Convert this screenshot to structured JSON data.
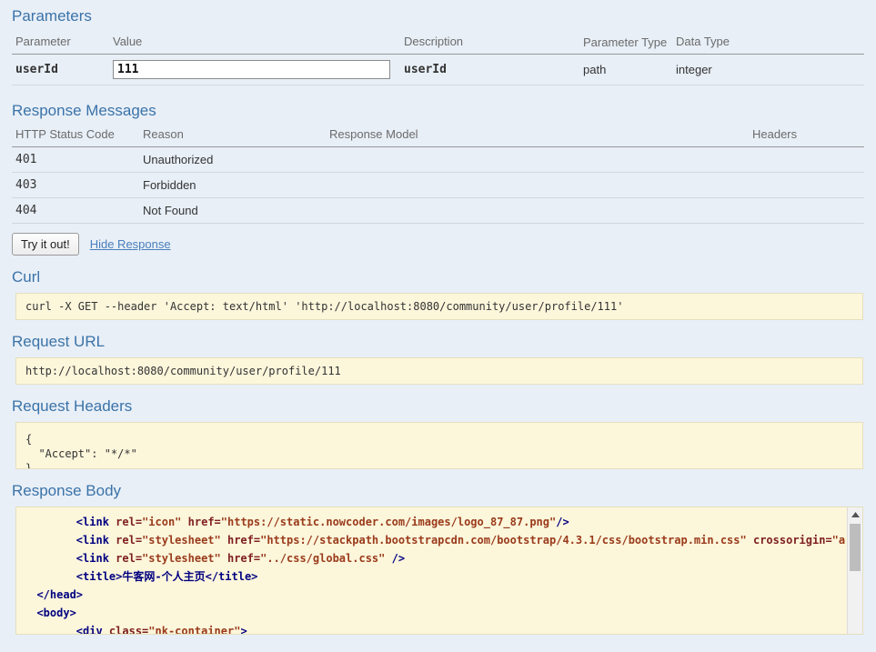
{
  "parameters": {
    "title": "Parameters",
    "headers": [
      "Parameter",
      "Value",
      "Description",
      "Parameter Type",
      "Data Type"
    ],
    "rows": [
      {
        "name": "userId",
        "value": "111",
        "description": "userId",
        "parameter_type": "path",
        "data_type": "integer"
      }
    ]
  },
  "response_messages": {
    "title": "Response Messages",
    "headers": [
      "HTTP Status Code",
      "Reason",
      "Response Model",
      "Headers"
    ],
    "rows": [
      {
        "code": "401",
        "reason": "Unauthorized",
        "model": "",
        "headers": ""
      },
      {
        "code": "403",
        "reason": "Forbidden",
        "model": "",
        "headers": ""
      },
      {
        "code": "404",
        "reason": "Not Found",
        "model": "",
        "headers": ""
      }
    ]
  },
  "actions": {
    "try_it_out": "Try it out!",
    "hide_response": "Hide Response"
  },
  "curl": {
    "title": "Curl",
    "command": "curl -X GET --header 'Accept: text/html' 'http://localhost:8080/community/user/profile/111'"
  },
  "request_url": {
    "title": "Request URL",
    "url": "http://localhost:8080/community/user/profile/111"
  },
  "request_headers": {
    "title": "Request Headers",
    "body": "{\n  \"Accept\": \"*/*\"\n}"
  },
  "response_body": {
    "title": "Response Body",
    "lines": [
      {
        "indent": 8,
        "parts": [
          {
            "t": "tag",
            "s": "<link "
          },
          {
            "t": "attr",
            "s": "rel="
          },
          {
            "t": "val",
            "s": "\"icon\" "
          },
          {
            "t": "attr",
            "s": "href="
          },
          {
            "t": "val",
            "s": "\"https://static.nowcoder.com/images/logo_87_87.png\""
          },
          {
            "t": "tag",
            "s": "/>"
          }
        ]
      },
      {
        "indent": 8,
        "parts": [
          {
            "t": "tag",
            "s": "<link "
          },
          {
            "t": "attr",
            "s": "rel="
          },
          {
            "t": "val",
            "s": "\"stylesheet\" "
          },
          {
            "t": "attr",
            "s": "href="
          },
          {
            "t": "val",
            "s": "\"https://stackpath.bootstrapcdn.com/bootstrap/4.3.1/css/bootstrap.min.css\" "
          },
          {
            "t": "attr",
            "s": "crossorigin="
          },
          {
            "t": "val",
            "s": "\"a"
          }
        ]
      },
      {
        "indent": 8,
        "parts": [
          {
            "t": "tag",
            "s": "<link "
          },
          {
            "t": "attr",
            "s": "rel="
          },
          {
            "t": "val",
            "s": "\"stylesheet\" "
          },
          {
            "t": "attr",
            "s": "href="
          },
          {
            "t": "val",
            "s": "\"../css/global.css\" "
          },
          {
            "t": "tag",
            "s": "/>"
          }
        ]
      },
      {
        "indent": 8,
        "parts": [
          {
            "t": "tag",
            "s": "<title>"
          },
          {
            "t": "txt",
            "s": "牛客网-个人主页"
          },
          {
            "t": "tag",
            "s": "</title>"
          }
        ]
      },
      {
        "indent": 2,
        "parts": [
          {
            "t": "tag",
            "s": "</head>"
          }
        ]
      },
      {
        "indent": 2,
        "parts": [
          {
            "t": "tag",
            "s": "<body>"
          }
        ]
      },
      {
        "indent": 8,
        "parts": [
          {
            "t": "tag",
            "s": "<div "
          },
          {
            "t": "attr",
            "s": "class="
          },
          {
            "t": "val",
            "s": "\"nk-container\""
          },
          {
            "t": "tag",
            "s": ">"
          }
        ]
      }
    ]
  },
  "colors": {
    "page_background": "#e8eff7",
    "heading": "#3b73a8",
    "code_background": "#fcf6db",
    "link": "#4a7fbb"
  }
}
